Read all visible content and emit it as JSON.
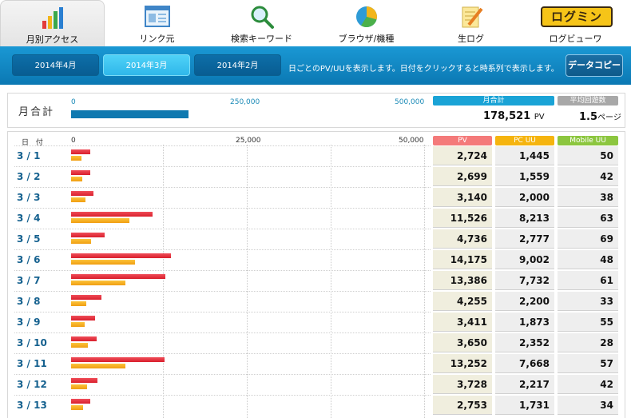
{
  "nav": {
    "items": [
      {
        "label": "月別アクセス",
        "icon": "bar-chart-icon",
        "active": true
      },
      {
        "label": "リンク元",
        "icon": "window-icon",
        "active": false
      },
      {
        "label": "検索キーワード",
        "icon": "magnifier-icon",
        "active": false
      },
      {
        "label": "ブラウザ/機種",
        "icon": "pie-chart-icon",
        "active": false
      },
      {
        "label": "生ログ",
        "icon": "pencil-paper-icon",
        "active": false
      },
      {
        "label": "ログビューワ",
        "icon": "logmin-logo-icon",
        "active": false
      }
    ],
    "logo_text": "ログミン"
  },
  "months": {
    "tabs": [
      "2014年4月",
      "2014年3月",
      "2014年2月"
    ],
    "active_index": 1,
    "info": "日ごとのPV/UUを表示します。日付をクリックすると時系列で表示します。",
    "copy_button": "データコピー"
  },
  "summary": {
    "label": "月合計",
    "scale": [
      "0",
      "250,000",
      "500,000"
    ],
    "total_pv": 178521,
    "scale_max": 500000,
    "pill_total": "月合計",
    "total_value": "178,521",
    "total_unit": "PV",
    "pill_avg": "平均回遊数",
    "avg_value": "1.5",
    "avg_unit": "ページ"
  },
  "table": {
    "date_header": "日 付",
    "scale": [
      "0",
      "25,000",
      "50,000"
    ],
    "scale_max": 50000,
    "col_pv": "PV",
    "col_pcuu": "PC UU",
    "col_mobileuu": "Mobile UU",
    "rows": [
      {
        "date": "3 / 1",
        "pv": "2,724",
        "pcuu": "1,445",
        "muu": "50",
        "pv_n": 2724,
        "uu_n": 1445
      },
      {
        "date": "3 / 2",
        "pv": "2,699",
        "pcuu": "1,559",
        "muu": "42",
        "pv_n": 2699,
        "uu_n": 1559
      },
      {
        "date": "3 / 3",
        "pv": "3,140",
        "pcuu": "2,000",
        "muu": "38",
        "pv_n": 3140,
        "uu_n": 2000
      },
      {
        "date": "3 / 4",
        "pv": "11,526",
        "pcuu": "8,213",
        "muu": "63",
        "pv_n": 11526,
        "uu_n": 8213
      },
      {
        "date": "3 / 5",
        "pv": "4,736",
        "pcuu": "2,777",
        "muu": "69",
        "pv_n": 4736,
        "uu_n": 2777
      },
      {
        "date": "3 / 6",
        "pv": "14,175",
        "pcuu": "9,002",
        "muu": "48",
        "pv_n": 14175,
        "uu_n": 9002
      },
      {
        "date": "3 / 7",
        "pv": "13,386",
        "pcuu": "7,732",
        "muu": "61",
        "pv_n": 13386,
        "uu_n": 7732
      },
      {
        "date": "3 / 8",
        "pv": "4,255",
        "pcuu": "2,200",
        "muu": "33",
        "pv_n": 4255,
        "uu_n": 2200
      },
      {
        "date": "3 / 9",
        "pv": "3,411",
        "pcuu": "1,873",
        "muu": "55",
        "pv_n": 3411,
        "uu_n": 1873
      },
      {
        "date": "3 / 10",
        "pv": "3,650",
        "pcuu": "2,352",
        "muu": "28",
        "pv_n": 3650,
        "uu_n": 2352
      },
      {
        "date": "3 / 11",
        "pv": "13,252",
        "pcuu": "7,668",
        "muu": "57",
        "pv_n": 13252,
        "uu_n": 7668
      },
      {
        "date": "3 / 12",
        "pv": "3,728",
        "pcuu": "2,217",
        "muu": "42",
        "pv_n": 3728,
        "uu_n": 2217
      },
      {
        "date": "3 / 13",
        "pv": "2,753",
        "pcuu": "1,731",
        "muu": "34",
        "pv_n": 2753,
        "uu_n": 1731
      }
    ]
  },
  "colors": {
    "header_blue": "#0b78b3",
    "pv_pill": "#f47a7a",
    "pcuu_pill": "#f5b40f",
    "mobile_pill": "#8cc63f",
    "total_pill": "#1aa3d6",
    "avg_pill": "#a8a8a8"
  }
}
